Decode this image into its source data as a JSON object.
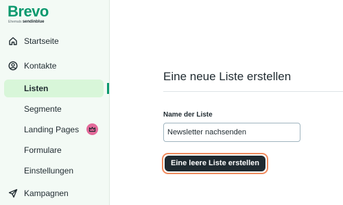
{
  "brand": {
    "name": "Brevo",
    "sub_prefix": "Ehemals",
    "sub_name": "sendinblue",
    "color": "#0b996e"
  },
  "sidebar": {
    "items": [
      {
        "label": "Startseite",
        "icon": "home-icon"
      },
      {
        "label": "Kontakte",
        "icon": "user-circle-icon"
      },
      {
        "label": "Listen",
        "active": true
      },
      {
        "label": "Segmente"
      },
      {
        "label": "Landing Pages",
        "badge_icon": "crown-icon"
      },
      {
        "label": "Formulare"
      },
      {
        "label": "Einstellungen"
      },
      {
        "label": "Kampagnen",
        "icon": "send-icon"
      }
    ],
    "active_color": "#d8f6d9",
    "badge_color": "#e36a9a"
  },
  "main": {
    "title": "Eine neue Liste erstellen",
    "field_label": "Name der Liste",
    "field_value": "Newsletter nachsenden",
    "submit_label": "Eine leere Liste erstellen",
    "button_ring_color": "#f08a5d"
  }
}
